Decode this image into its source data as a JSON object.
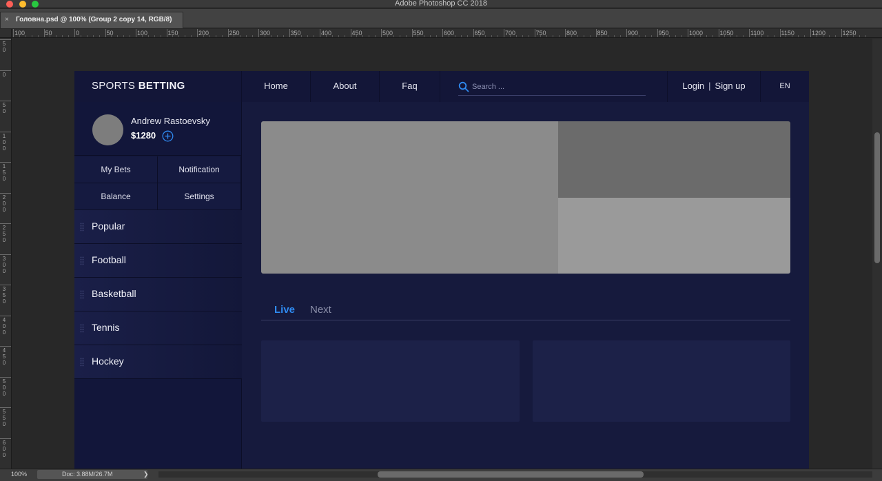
{
  "window": {
    "app_title": "Adobe Photoshop CC 2018",
    "doc_tab": "Головна.psd @ 100% (Group 2 copy 14, RGB/8)",
    "close_glyph": "×"
  },
  "rulers": {
    "top_labels": [
      "100",
      "50",
      "0",
      "50",
      "100",
      "150",
      "200",
      "250",
      "300",
      "350",
      "400",
      "450",
      "500",
      "550",
      "600",
      "650",
      "700",
      "750",
      "800",
      "850",
      "900",
      "950",
      "1000",
      "1050",
      "1100",
      "1150",
      "1200",
      "1250"
    ],
    "left_labels": [
      "50",
      "0",
      "50",
      "100",
      "150",
      "200",
      "250",
      "300",
      "350",
      "400",
      "450",
      "500",
      "550",
      "600"
    ]
  },
  "status": {
    "zoom": "100%",
    "doc_info": "Doc: 3.88M/26.7M",
    "arrow": "❯"
  },
  "site": {
    "logo_light": "SPORTS ",
    "logo_bold": "BETTING",
    "nav": [
      "Home",
      "About",
      "Faq"
    ],
    "search_placeholder": "Search ...",
    "login": "Login",
    "auth_separator": "|",
    "signup": "Sign up",
    "language": "EN",
    "user": {
      "name": "Andrew Rastoevsky",
      "balance": "$1280"
    },
    "account_buttons": [
      "My Bets",
      "Notification",
      "Balance",
      "Settings"
    ],
    "sports": [
      "Popular",
      "Football",
      "Basketball",
      "Tennis",
      "Hockey"
    ],
    "tabs": {
      "live": "Live",
      "next": "Next"
    },
    "colors": {
      "accent": "#2f8bf2",
      "background": "#161a3d",
      "header": "#131638"
    }
  },
  "icons": [
    "search-icon",
    "add-circle-icon",
    "drag-handle-icon"
  ]
}
